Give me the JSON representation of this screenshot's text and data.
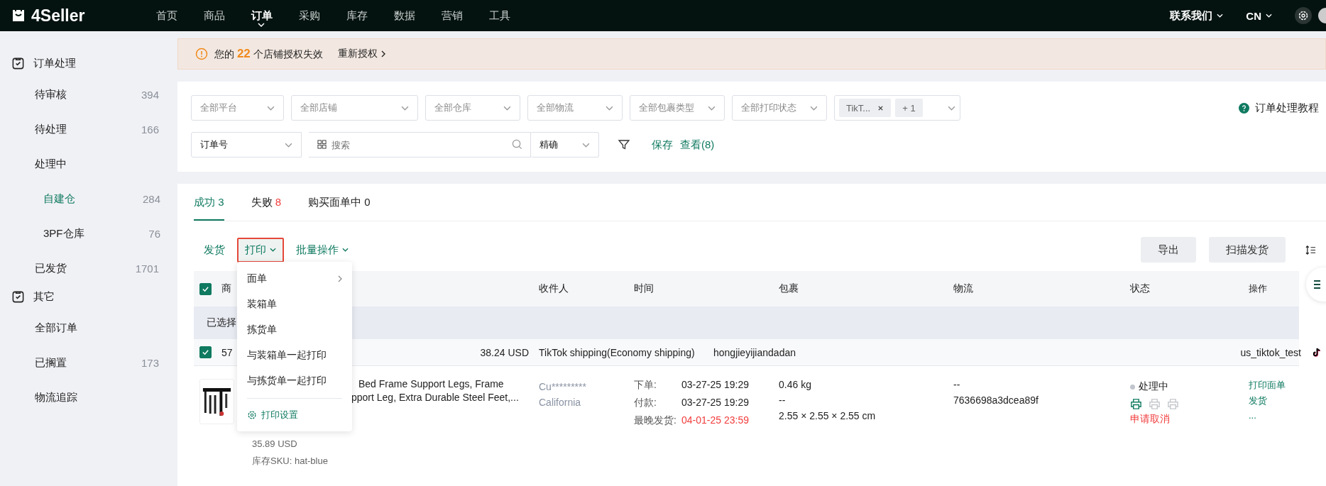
{
  "topbar": {
    "logo": "4Seller",
    "nav": [
      {
        "label": "首页",
        "selected": false
      },
      {
        "label": "商品",
        "selected": false
      },
      {
        "label": "订单",
        "selected": true
      },
      {
        "label": "采购",
        "selected": false
      },
      {
        "label": "库存",
        "selected": false
      },
      {
        "label": "数据",
        "selected": false
      },
      {
        "label": "营销",
        "selected": false
      },
      {
        "label": "工具",
        "selected": false
      }
    ],
    "contact": "联系我们",
    "language": "CN"
  },
  "sidebar": {
    "groups": [
      {
        "title": "订单处理",
        "items": [
          {
            "label": "待审核",
            "count": "394",
            "selected": false
          },
          {
            "label": "待处理",
            "count": "166",
            "selected": false
          },
          {
            "label": "处理中",
            "selected": false,
            "children": [
              {
                "label": "自建仓",
                "count": "284",
                "selected": true
              },
              {
                "label": "3PF仓库",
                "count": "76",
                "selected": false
              }
            ]
          },
          {
            "label": "已发货",
            "count": "1701",
            "selected": false
          }
        ]
      },
      {
        "title": "其它",
        "items": [
          {
            "label": "全部订单",
            "selected": false
          },
          {
            "label": "已搁置",
            "count": "173",
            "selected": false
          },
          {
            "label": "物流追踪",
            "selected": false
          }
        ]
      }
    ]
  },
  "alert": {
    "prefix": "您的",
    "count": "22",
    "suffix": "个店铺授权失效",
    "action": "重新授权"
  },
  "filters": {
    "selects": [
      {
        "placeholder": "全部平台"
      },
      {
        "placeholder": "全部店铺"
      },
      {
        "placeholder": "全部仓库"
      },
      {
        "placeholder": "全部物流"
      },
      {
        "placeholder": "全部包裹类型"
      },
      {
        "placeholder": "全部打印状态"
      }
    ],
    "tag_select": {
      "tags": [
        "TikT...",
        "+ 1"
      ]
    },
    "help": "订单处理教程",
    "search_type": "订单号",
    "search": {
      "placeholder": "搜索"
    },
    "match": "精确",
    "save": "保存",
    "view": "查看(8)"
  },
  "tabs": [
    {
      "label": "成功",
      "count": "3",
      "selected": true,
      "alert": false
    },
    {
      "label": "失败",
      "count": "8",
      "selected": false,
      "alert": true
    },
    {
      "label": "购买面单中",
      "count": "0",
      "selected": false,
      "alert": false
    }
  ],
  "toolbar": {
    "actions": [
      {
        "label": "发货",
        "kind": "link",
        "highlighted": false
      },
      {
        "label": "打印",
        "kind": "dropdown",
        "highlighted": true
      },
      {
        "label": "批量操作",
        "kind": "dropdown",
        "highlighted": false
      }
    ],
    "buttons": [
      "导出",
      "扫描发货"
    ]
  },
  "print_menu": {
    "items": [
      {
        "label": "面单",
        "kind": "submenu"
      },
      {
        "label": "装箱单",
        "kind": "item"
      },
      {
        "label": "拣货单",
        "kind": "item"
      },
      {
        "label": "与装箱单一起打印",
        "kind": "item"
      },
      {
        "label": "与拣货单一起打印",
        "kind": "item"
      }
    ],
    "settings": "打印设置"
  },
  "table": {
    "header_checked": true,
    "columns": [
      "商",
      "收件人",
      "时间",
      "包裹",
      "物流",
      "状态",
      "操作"
    ],
    "selection_text": "已选择",
    "order": {
      "checked": true,
      "number": "57",
      "total": "38.24 USD",
      "shipping": "TikTok shipping(Economy shipping)",
      "carrier": "hongjieyijiandadan",
      "store": "us_tiktok_test",
      "product": {
        "title_lines": [
          "Bed Frame Support Legs, Frame",
          "pport Leg, Extra Durable Steel Feet,..."
        ],
        "price": "35.89 USD",
        "sku": "库存SKU: hat-blue"
      },
      "recipient": {
        "name": "Cu*********",
        "region": "California"
      },
      "times": [
        {
          "label": "下单:",
          "value": "03-27-25 19:29",
          "overdue": false
        },
        {
          "label": "付款:",
          "value": "03-27-25 19:29",
          "overdue": false
        },
        {
          "label": "最晚发货:",
          "value": "04-01-25 23:59",
          "overdue": true
        }
      ],
      "package": [
        "0.46 kg",
        "--",
        "2.55 × 2.55 × 2.55 cm"
      ],
      "tracking": [
        "--",
        "7636698a3dcea89f"
      ],
      "status": "处理中",
      "print_icons": [
        {
          "done": true
        },
        {
          "done": false
        },
        {
          "done": false
        }
      ],
      "cancel": "申请取消",
      "operations": [
        "打印面单",
        "发货",
        "..."
      ]
    }
  }
}
